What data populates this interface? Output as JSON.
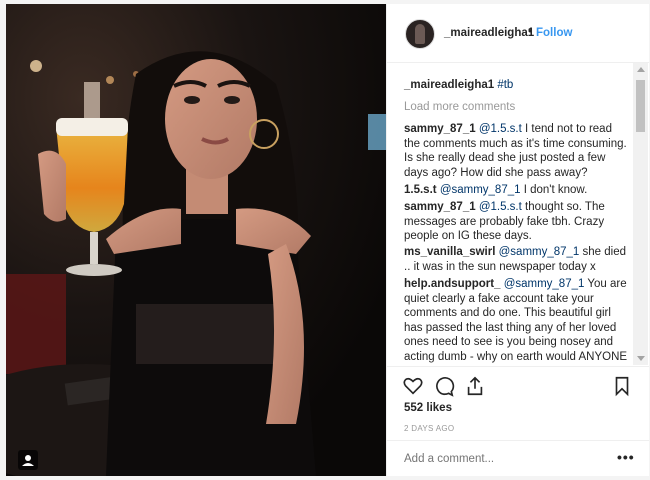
{
  "post": {
    "username": "_maireadleigha1",
    "separator": "•",
    "follow_label": "Follow"
  },
  "caption": {
    "username": "_maireadleigha1",
    "hashtag": "#tb"
  },
  "load_more_label": "Load more comments",
  "comments": [
    {
      "user": "sammy_87_1",
      "mention": "@1.5.s.t",
      "text": " I tend not to read the comments much as it's time consuming. Is she really dead she just posted a few days ago? How did she pass away?"
    },
    {
      "user": "1.5.s.t",
      "mention": "@sammy_87_1",
      "text": " I don't know."
    },
    {
      "user": "sammy_87_1",
      "mention": "@1.5.s.t",
      "text": " thought so. The messages are probably fake tbh. Crazy people on IG these days."
    },
    {
      "user": "ms_vanilla_swirl",
      "mention": "@sammy_87_1",
      "text": " she died .. it was in the sun newspaper today x"
    },
    {
      "user": "help.andsupport_",
      "mention": "@sammy_87_1",
      "text": " You are quiet clearly a fake account take your comments and do one. This beautiful girl has passed the last thing any of her loved ones need to see is you being nosey and acting dumb - why on earth would ANYONE make this up. Have a bit of"
    }
  ],
  "likes_text": "552 likes",
  "time_ago": "2 DAYS AGO",
  "add_comment_placeholder": "Add a comment...",
  "more_options": "•••",
  "colors": {
    "link_blue": "#3897f0",
    "mention_blue": "#003569",
    "muted": "#999999"
  },
  "icons": [
    "heart-icon",
    "comment-icon",
    "share-icon",
    "bookmark-icon",
    "user-tag-icon"
  ]
}
